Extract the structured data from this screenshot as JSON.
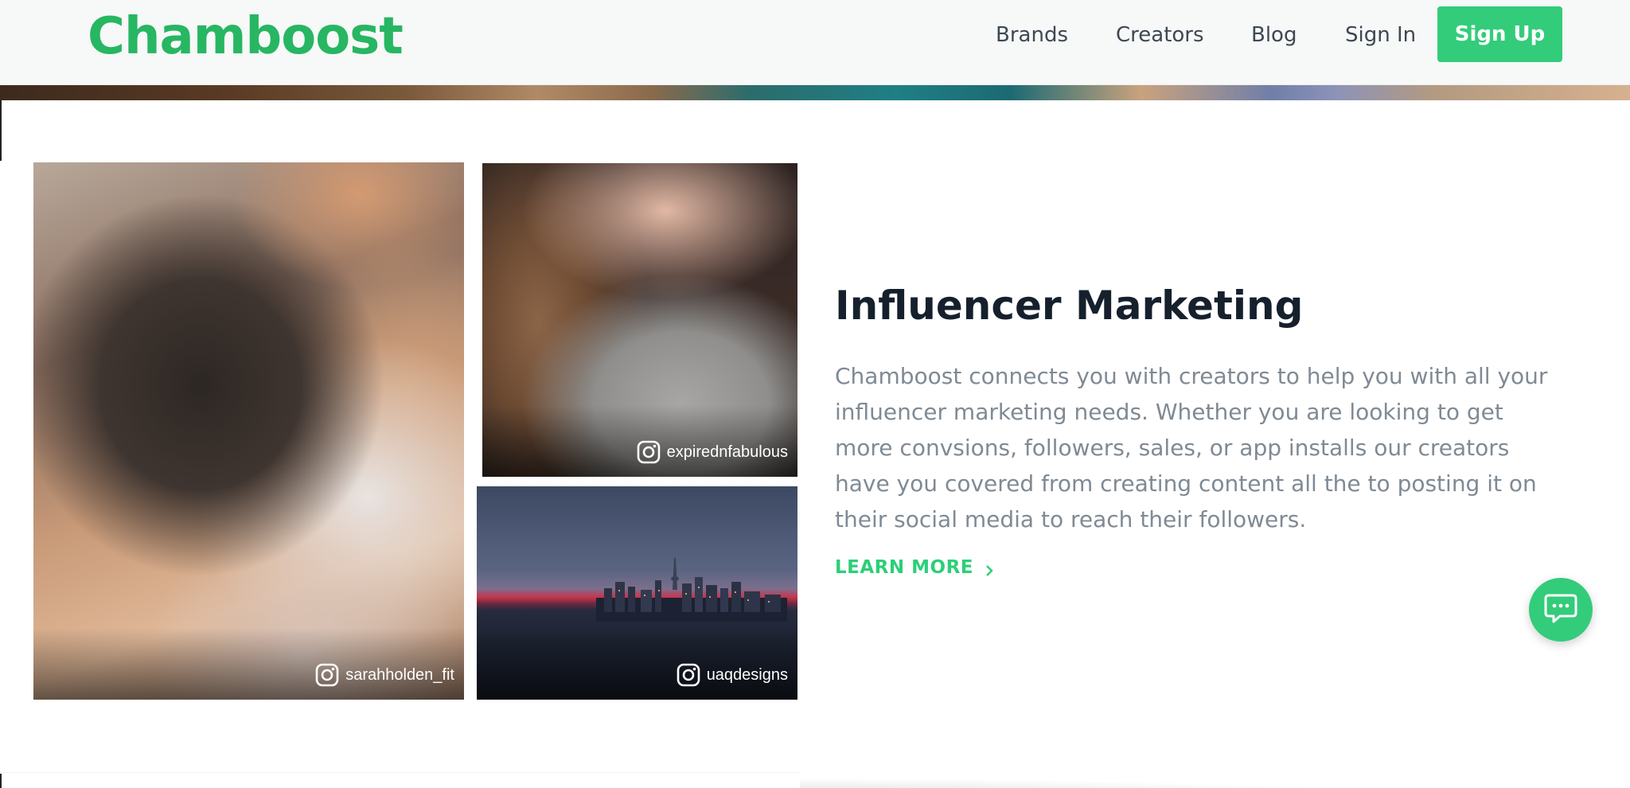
{
  "header": {
    "logo_text": "Chamboost",
    "nav": [
      {
        "label": "Brands"
      },
      {
        "label": "Creators"
      },
      {
        "label": "Blog"
      },
      {
        "label": "Sign In"
      }
    ],
    "signup_label": "Sign Up"
  },
  "gallery": [
    {
      "handle": "sarahholden_fit",
      "icon": "instagram-icon"
    },
    {
      "handle": "expirednfabulous",
      "icon": "instagram-icon"
    },
    {
      "handle": "uaqdesigns",
      "icon": "instagram-icon"
    }
  ],
  "section": {
    "title": "Influencer Marketing",
    "description": "Chamboost connects you with creators to help you with all your influencer marketing needs. Whether you are looking to get more convsions, followers, sales, or app installs our creators have you covered from creating content all the to posting it on their social media to reach their followers.",
    "cta_label": "LEARN MORE"
  },
  "chat": {
    "icon": "chat-bubble-icon"
  },
  "colors": {
    "brand": "#27b662",
    "button": "#33cc7a",
    "title": "#16202d",
    "body_text": "#7f8a94",
    "nav_text": "#3d4852"
  }
}
